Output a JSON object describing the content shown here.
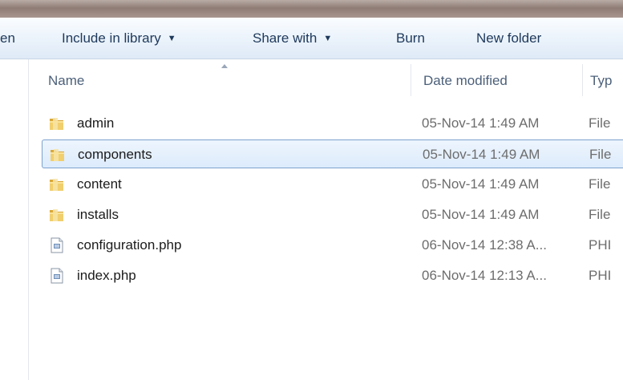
{
  "toolbar": {
    "cut_label": "en",
    "include_label": "Include in library",
    "share_label": "Share with",
    "burn_label": "Burn",
    "newfolder_label": "New folder",
    "caret": "▼"
  },
  "columns": {
    "name": "Name",
    "date": "Date modified",
    "type": "Typ"
  },
  "sort": {
    "column": "name",
    "direction": "ascending"
  },
  "files": [
    {
      "name": "admin",
      "date": "05-Nov-14 1:49 AM",
      "type": "File",
      "kind": "folder-icon"
    },
    {
      "name": "components",
      "date": "05-Nov-14 1:49 AM",
      "type": "File",
      "kind": "folder-icon",
      "selected": true
    },
    {
      "name": "content",
      "date": "05-Nov-14 1:49 AM",
      "type": "File",
      "kind": "folder-icon"
    },
    {
      "name": "installs",
      "date": "05-Nov-14 1:49 AM",
      "type": "File",
      "kind": "folder-icon"
    },
    {
      "name": "configuration.php",
      "date": "06-Nov-14 12:38 A...",
      "type": "PHI",
      "kind": "php-file-icon"
    },
    {
      "name": "index.php",
      "date": "06-Nov-14 12:13 A...",
      "type": "PHI",
      "kind": "php-file-icon"
    }
  ],
  "colors": {
    "toolbar_text": "#1e395b",
    "selection_border": "#7da2ce",
    "folder_yellow": "#e8c25a"
  }
}
